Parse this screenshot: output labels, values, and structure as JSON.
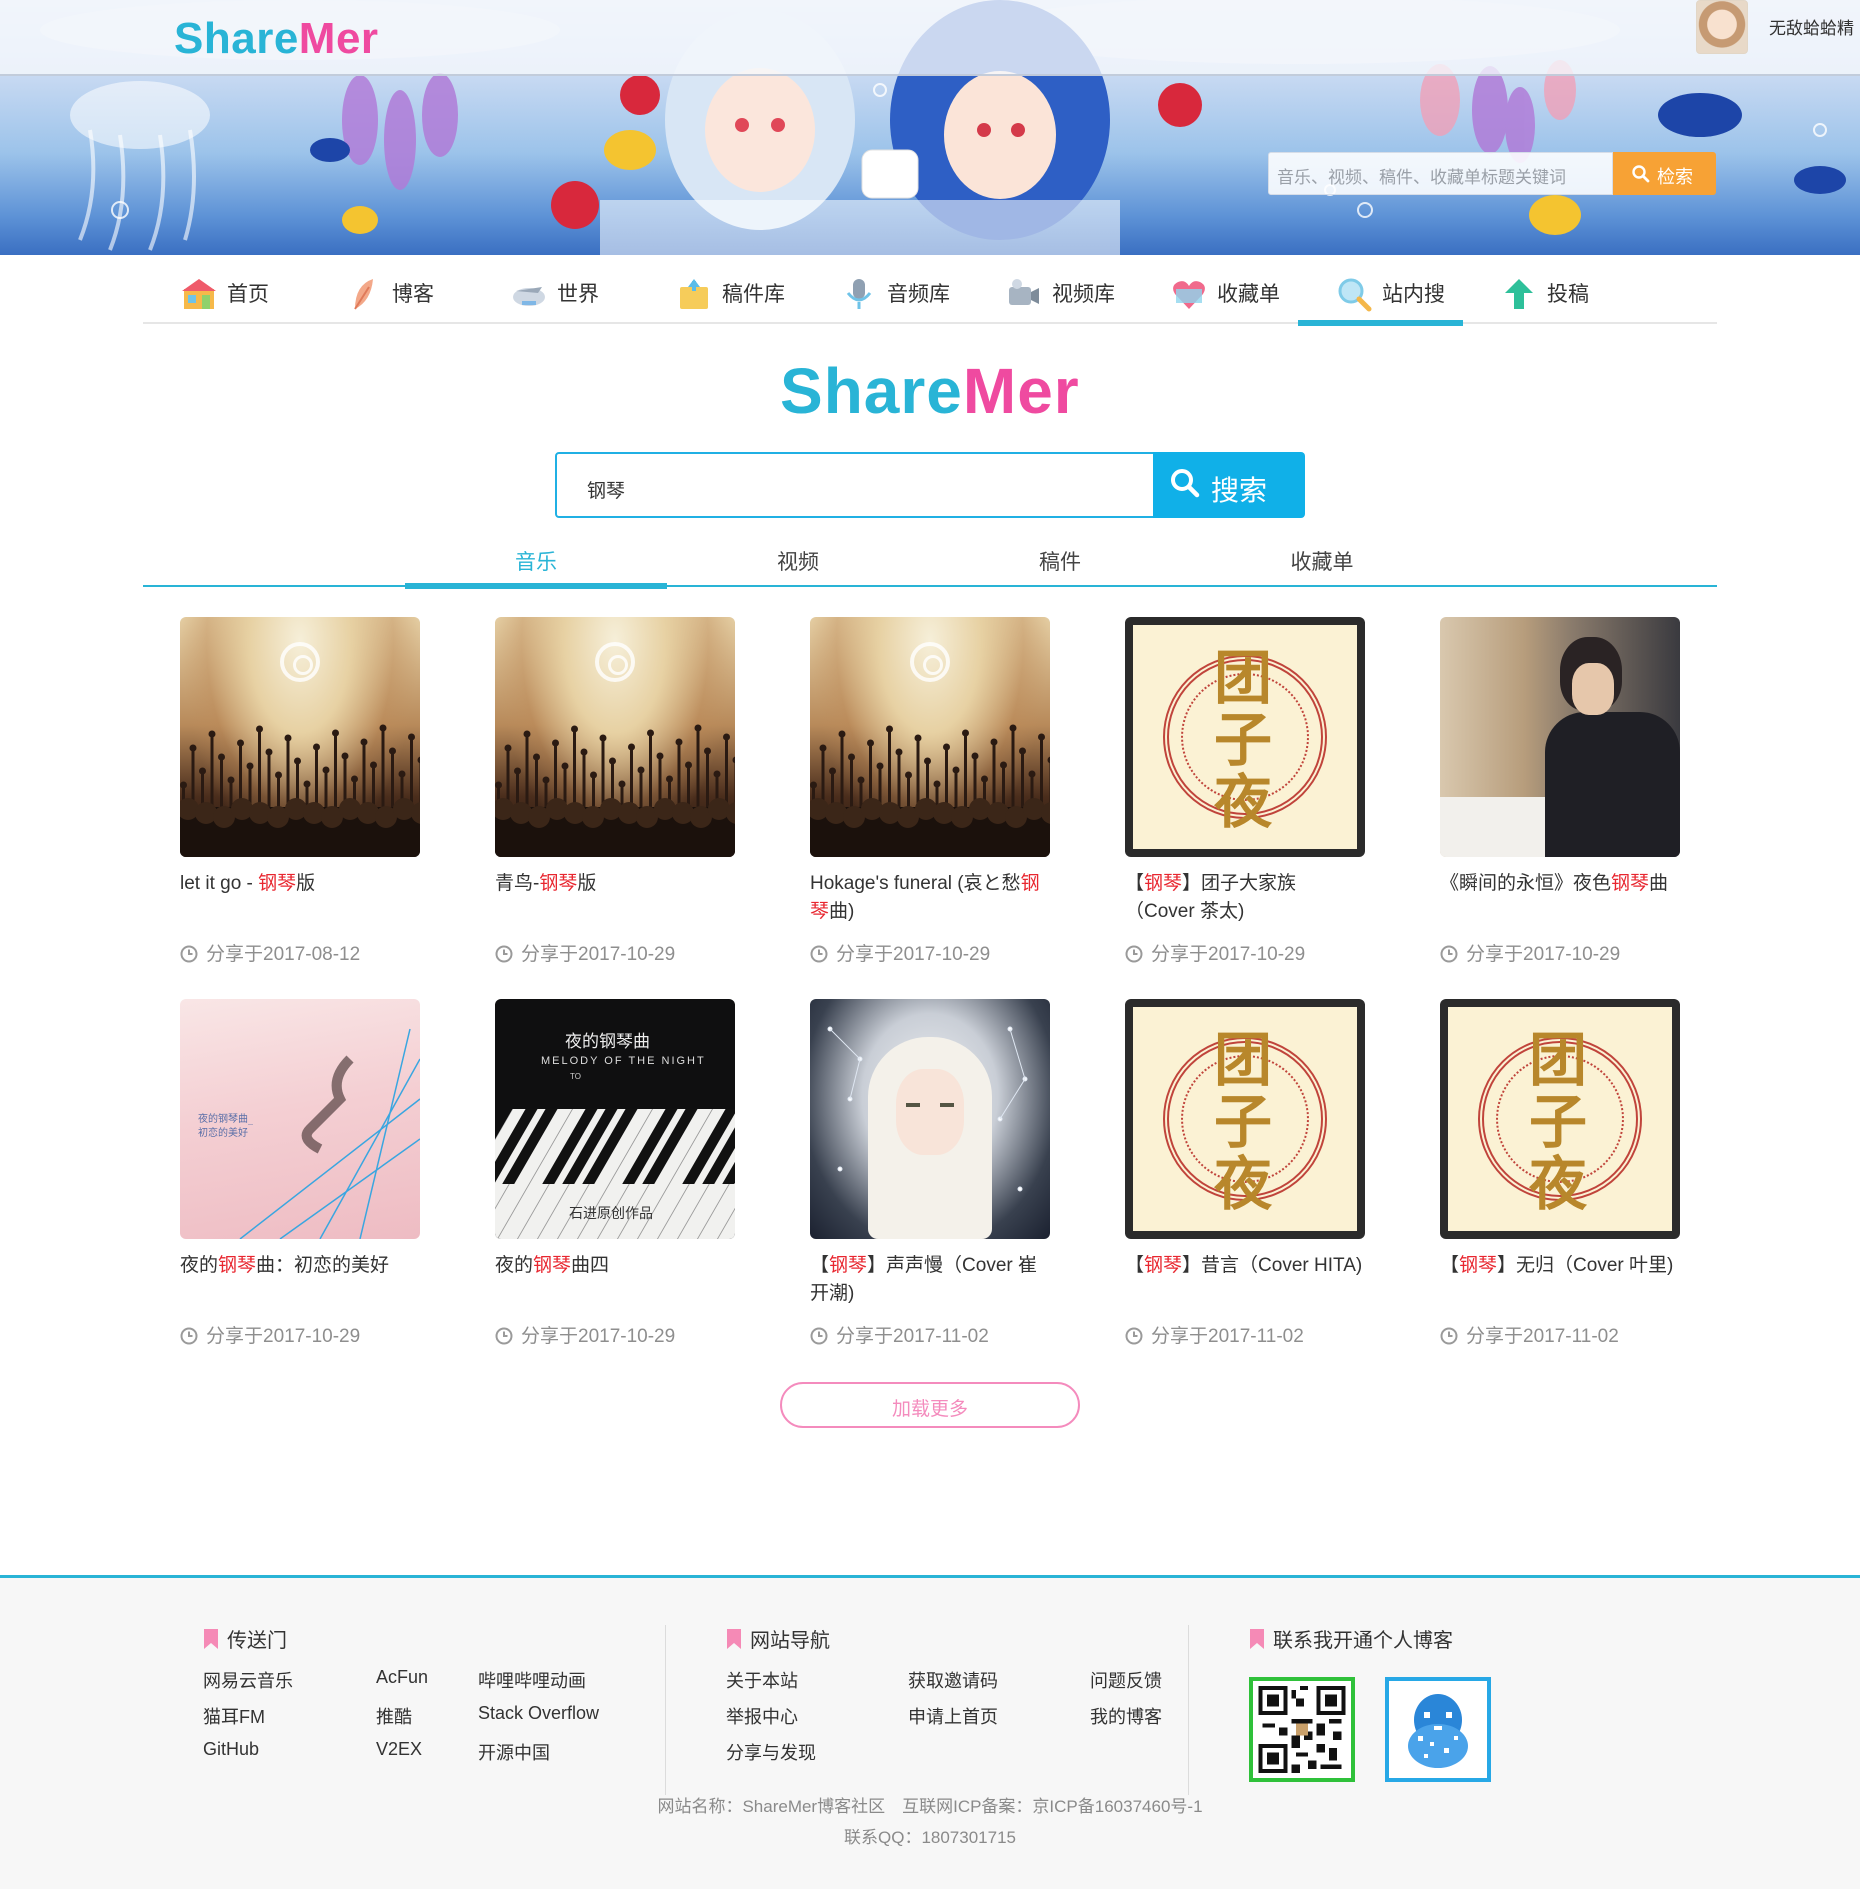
{
  "header": {
    "logo_share": "Share",
    "logo_mer": "Mer",
    "username": "无敌蛤蛤精",
    "search_placeholder": "音乐、视频、稿件、收藏单标题关键词",
    "search_button": "检索"
  },
  "nav": {
    "items": [
      {
        "label": "首页",
        "icon": "home-icon"
      },
      {
        "label": "博客",
        "icon": "feather-icon"
      },
      {
        "label": "世界",
        "icon": "globe-icon"
      },
      {
        "label": "稿件库",
        "icon": "folder-icon"
      },
      {
        "label": "音频库",
        "icon": "microphone-icon"
      },
      {
        "label": "视频库",
        "icon": "camera-icon"
      },
      {
        "label": "收藏单",
        "icon": "heart-icon"
      },
      {
        "label": "站内搜",
        "icon": "search-icon"
      },
      {
        "label": "投稿",
        "icon": "upload-icon"
      }
    ],
    "active": "站内搜"
  },
  "search": {
    "logo_share": "Share",
    "logo_mer": "Mer",
    "query": "钢琴",
    "button": "搜索"
  },
  "tabs": {
    "items": [
      "音乐",
      "视频",
      "稿件",
      "收藏单"
    ],
    "active": "音乐"
  },
  "results": [
    {
      "title_parts": [
        "let it go - ",
        "钢琴",
        "版"
      ],
      "date": "分享于2017-08-12",
      "cover": "concert"
    },
    {
      "title_parts": [
        "青鸟-",
        "钢琴",
        "版"
      ],
      "date": "分享于2017-10-29",
      "cover": "concert"
    },
    {
      "title_parts": [
        "Hokage's funeral (哀と愁",
        "钢琴",
        "曲)"
      ],
      "date": "分享于2017-10-29",
      "cover": "concert"
    },
    {
      "title_parts": [
        "【",
        "钢琴",
        "】团子大家族（Cover 茶太)"
      ],
      "date": "分享于2017-10-29",
      "cover": "poster"
    },
    {
      "title_parts": [
        "《瞬间的永恒》夜色",
        "钢琴",
        "曲"
      ],
      "date": "分享于2017-10-29",
      "cover": "pianist"
    },
    {
      "title_parts": [
        "夜的",
        "钢琴",
        "曲：初恋的美好"
      ],
      "date": "分享于2017-10-29",
      "cover": "pink"
    },
    {
      "title_parts": [
        "夜的",
        "钢琴",
        "曲四"
      ],
      "date": "分享于2017-10-29",
      "cover": "night"
    },
    {
      "title_parts": [
        "【",
        "钢琴",
        "】声声慢（Cover 崔开潮)"
      ],
      "date": "分享于2017-11-02",
      "cover": "anime"
    },
    {
      "title_parts": [
        "【",
        "钢琴",
        "】昔言（Cover HITA)"
      ],
      "date": "分享于2017-11-02",
      "cover": "poster"
    },
    {
      "title_parts": [
        "【",
        "钢琴",
        "】无归（Cover 叶里)"
      ],
      "date": "分享于2017-11-02",
      "cover": "poster"
    }
  ],
  "covers": {
    "pink_text": "夜的钢琴曲_\n初恋的美好",
    "night_title": "夜的钢琴曲",
    "night_subtitle": "MELODY OF THE NIGHT",
    "night_to": "TO",
    "night_signature": "石进原创作品",
    "poster_glyph": "团\n子\n夜"
  },
  "load_more": "加载更多",
  "footer": {
    "portal": {
      "title": "传送门",
      "links": [
        "网易云音乐",
        "AcFun",
        "哔哩哔哩动画",
        "猫耳FM",
        "推酷",
        "Stack Overflow",
        "GitHub",
        "V2EX",
        "开源中国"
      ]
    },
    "site_nav": {
      "title": "网站导航",
      "links": [
        "关于本站",
        "获取邀请码",
        "问题反馈",
        "举报中心",
        "申请上首页",
        "我的博客",
        "分享与发现"
      ]
    },
    "contact": {
      "title": "联系我开通个人博客"
    },
    "info_line1": "网站名称：ShareMer博客社区　互联网ICP备案：京ICP备16037460号-1",
    "info_line2": "联系QQ：1807301715"
  },
  "colors": {
    "brand_blue": "#29b4d6",
    "brand_pink": "#ef4aa0",
    "highlight_red": "#e8262f",
    "search_orange": "#f7a235"
  }
}
